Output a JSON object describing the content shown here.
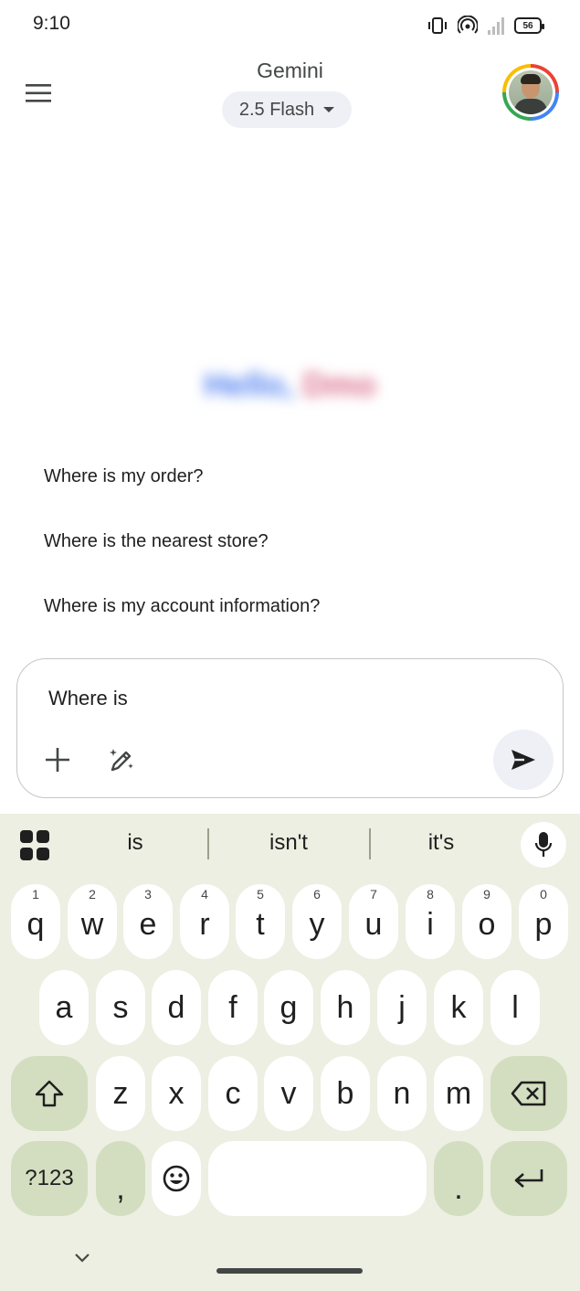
{
  "status_bar": {
    "time": "9:10",
    "battery": "56"
  },
  "header": {
    "title": "Gemini",
    "model": "2.5 Flash"
  },
  "greeting": {
    "part1": "Hello,",
    "part2": "Dmo"
  },
  "suggestions": [
    "Where is my order?",
    "Where is the nearest store?",
    "Where is my account information?"
  ],
  "input": {
    "value": "Where is"
  },
  "keyboard": {
    "suggestions": [
      "is",
      "isn't",
      "it's"
    ],
    "row1": [
      {
        "k": "q",
        "h": "1"
      },
      {
        "k": "w",
        "h": "2"
      },
      {
        "k": "e",
        "h": "3"
      },
      {
        "k": "r",
        "h": "4"
      },
      {
        "k": "t",
        "h": "5"
      },
      {
        "k": "y",
        "h": "6"
      },
      {
        "k": "u",
        "h": "7"
      },
      {
        "k": "i",
        "h": "8"
      },
      {
        "k": "o",
        "h": "9"
      },
      {
        "k": "p",
        "h": "0"
      }
    ],
    "row2": [
      "a",
      "s",
      "d",
      "f",
      "g",
      "h",
      "j",
      "k",
      "l"
    ],
    "row3": [
      "z",
      "x",
      "c",
      "v",
      "b",
      "n",
      "m"
    ],
    "symbols_label": "?123",
    "comma": ",",
    "period": "."
  }
}
